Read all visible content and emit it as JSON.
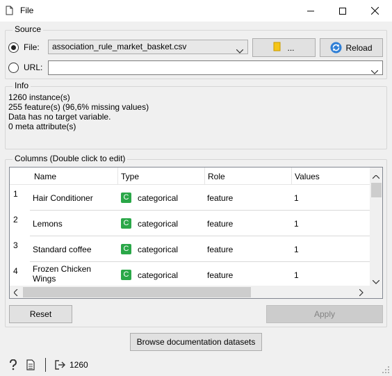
{
  "window": {
    "title": "File"
  },
  "source": {
    "group_title": "Source",
    "file_label": "File:",
    "file_value": "association_rule_market_basket.csv",
    "browse_label": "...",
    "reload_label": "Reload",
    "url_label": "URL:",
    "url_value": ""
  },
  "info": {
    "group_title": "Info",
    "lines": [
      "1260 instance(s)",
      "255 feature(s) (96,6% missing values)",
      "Data has no target variable.",
      "0 meta attribute(s)"
    ]
  },
  "columns": {
    "group_title": "Columns (Double click to edit)",
    "headers": [
      "Name",
      "Type",
      "Role",
      "Values"
    ],
    "rows": [
      {
        "num": "1",
        "name": "Hair Conditioner",
        "type_badge": "C",
        "type": "categorical",
        "role": "feature",
        "values": "1"
      },
      {
        "num": "2",
        "name": "Lemons",
        "type_badge": "C",
        "type": "categorical",
        "role": "feature",
        "values": "1"
      },
      {
        "num": "3",
        "name": "Standard coffee",
        "type_badge": "C",
        "type": "categorical",
        "role": "feature",
        "values": "1"
      },
      {
        "num": "4",
        "name": "Frozen Chicken Wings",
        "type_badge": "C",
        "type": "categorical",
        "role": "feature",
        "values": "1"
      }
    ]
  },
  "actions": {
    "reset_label": "Reset",
    "apply_label": "Apply",
    "browse_docs_label": "Browse documentation datasets"
  },
  "status": {
    "output_count": "1260"
  },
  "icons": {
    "title": "document-icon",
    "help": "help-icon",
    "report": "report-icon",
    "output": "output-icon",
    "reload": "reload-icon",
    "folder": "folder-icon"
  },
  "colors": {
    "categorical_badge": "#2aa748",
    "reload_blue": "#2f7fd6",
    "folder_yellow": "#f5c518"
  }
}
